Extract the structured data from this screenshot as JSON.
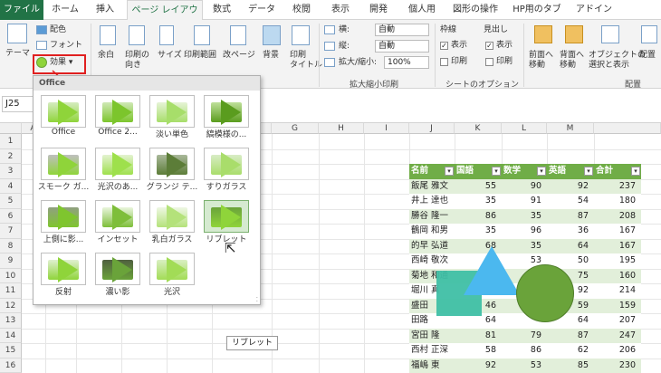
{
  "tabs": [
    {
      "label": "ファイル"
    },
    {
      "label": "ホーム"
    },
    {
      "label": "挿入"
    },
    {
      "label": "ページ レイアウト"
    },
    {
      "label": "数式"
    },
    {
      "label": "データ"
    },
    {
      "label": "校閲"
    },
    {
      "label": "表示"
    },
    {
      "label": "開発"
    },
    {
      "label": "個人用"
    },
    {
      "label": "図形の操作"
    },
    {
      "label": "HP用のタブ"
    },
    {
      "label": "アドイン"
    }
  ],
  "ribbon": {
    "theme": "テーマ",
    "colors": "配色",
    "fonts": "フォント",
    "effects": "効果",
    "margins": "余白",
    "orientation1": "印刷の",
    "orientation2": "向き",
    "size": "サイズ",
    "print_area": "印刷範囲",
    "breaks": "改ページ",
    "background": "背景",
    "print_titles1": "印刷",
    "print_titles2": "タイトル",
    "width_label": "横:",
    "width_value": "自動",
    "height_label": "縦:",
    "height_value": "自動",
    "scale_label": "拡大/縮小:",
    "scale_value": "100%",
    "scale_group": "拡大縮小印刷",
    "gridlines": "枠線",
    "headings": "見出し",
    "view": "表示",
    "print": "印刷",
    "sheet_options": "シートのオプション",
    "bring_forward1": "前面へ",
    "bring_forward2": "移動",
    "send_backward1": "背面へ",
    "send_backward2": "移動",
    "selection_pane1": "オブジェクトの",
    "selection_pane2": "選択と表示",
    "align": "配置",
    "arrange": "配置"
  },
  "namebox": "J25",
  "columns": [
    "A",
    "B",
    "C",
    "D",
    "E",
    "F",
    "G",
    "H",
    "I",
    "J",
    "K",
    "L",
    "M"
  ],
  "rows": [
    "1",
    "2",
    "3",
    "4",
    "5",
    "6",
    "7",
    "8",
    "9",
    "10",
    "11",
    "12",
    "13",
    "14",
    "15",
    "16"
  ],
  "table": {
    "headers": [
      "名前",
      "国語",
      "数学",
      "英語",
      "合計"
    ],
    "rows": [
      [
        "飯尾 雅文",
        "55",
        "90",
        "92",
        "237"
      ],
      [
        "井上 達也",
        "35",
        "91",
        "54",
        "180"
      ],
      [
        "勝谷 隆一",
        "86",
        "35",
        "87",
        "208"
      ],
      [
        "鶴岡 和男",
        "35",
        "96",
        "36",
        "167"
      ],
      [
        "的早 弘道",
        "68",
        "35",
        "64",
        "167"
      ],
      [
        "西崎 敬次",
        "71",
        "53",
        "50",
        "195"
      ],
      [
        "菊地 和通",
        "",
        "42",
        "75",
        "160"
      ],
      [
        "堀川 真",
        "",
        "",
        "92",
        "214"
      ],
      [
        "盛田",
        "46",
        "",
        "59",
        "159"
      ],
      [
        "田路",
        "64",
        "",
        "64",
        "207"
      ],
      [
        "宮田 隆",
        "81",
        "79",
        "87",
        "247"
      ],
      [
        "西村 正深",
        "58",
        "86",
        "62",
        "206"
      ],
      [
        "福嶋 東",
        "92",
        "53",
        "85",
        "230"
      ]
    ]
  },
  "gallery": {
    "header": "Office",
    "items": [
      {
        "label": "Office"
      },
      {
        "label": "Office 2..."
      },
      {
        "label": "淡い単色"
      },
      {
        "label": "縞模様の..."
      },
      {
        "label": "スモーク ガ..."
      },
      {
        "label": "光沢のあ..."
      },
      {
        "label": "グランジ テ..."
      },
      {
        "label": "すりガラス"
      },
      {
        "label": "上側に影..."
      },
      {
        "label": "インセット"
      },
      {
        "label": "乳白ガラス"
      },
      {
        "label": "リブレット"
      },
      {
        "label": "反射"
      },
      {
        "label": "濃い影"
      },
      {
        "label": "光沢"
      }
    ],
    "tooltip": "リブレット"
  },
  "colors": {
    "accent": "#217346",
    "header_green": "#70ad47",
    "annotation": "#e02020",
    "triangle": "#4bb8ef",
    "square": "#3fbfa5",
    "circle": "#6aa33a"
  }
}
